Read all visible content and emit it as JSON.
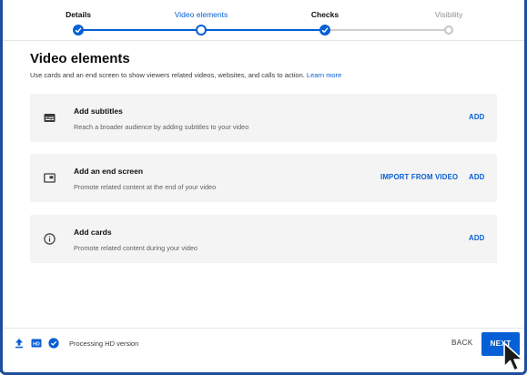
{
  "stepper": {
    "steps": [
      {
        "label": "Details",
        "state": "done"
      },
      {
        "label": "Video elements",
        "state": "active"
      },
      {
        "label": "Checks",
        "state": "done"
      },
      {
        "label": "Visibility",
        "state": "future"
      }
    ]
  },
  "page": {
    "title": "Video elements",
    "description": "Use cards and an end screen to show viewers related videos, websites, and calls to action.",
    "learn_more": "Learn more"
  },
  "cards": [
    {
      "icon": "subtitles-icon",
      "title": "Add subtitles",
      "subtitle": "Reach a broader audience by adding subtitles to your video",
      "add_label": "ADD"
    },
    {
      "icon": "end-screen-icon",
      "title": "Add an end screen",
      "subtitle": "Promote related content at the end of your video",
      "import_label": "IMPORT FROM VIDEO",
      "add_label": "ADD"
    },
    {
      "icon": "info-icon",
      "title": "Add cards",
      "subtitle": "Promote related content during your video",
      "add_label": "ADD"
    }
  ],
  "footer": {
    "status": "Processing HD version",
    "hd_badge": "HD",
    "back_label": "BACK",
    "next_label": "NEXT"
  },
  "colors": {
    "accent": "#065fd4",
    "frame": "#1f4e9e",
    "card_bg": "#f4f4f4"
  }
}
